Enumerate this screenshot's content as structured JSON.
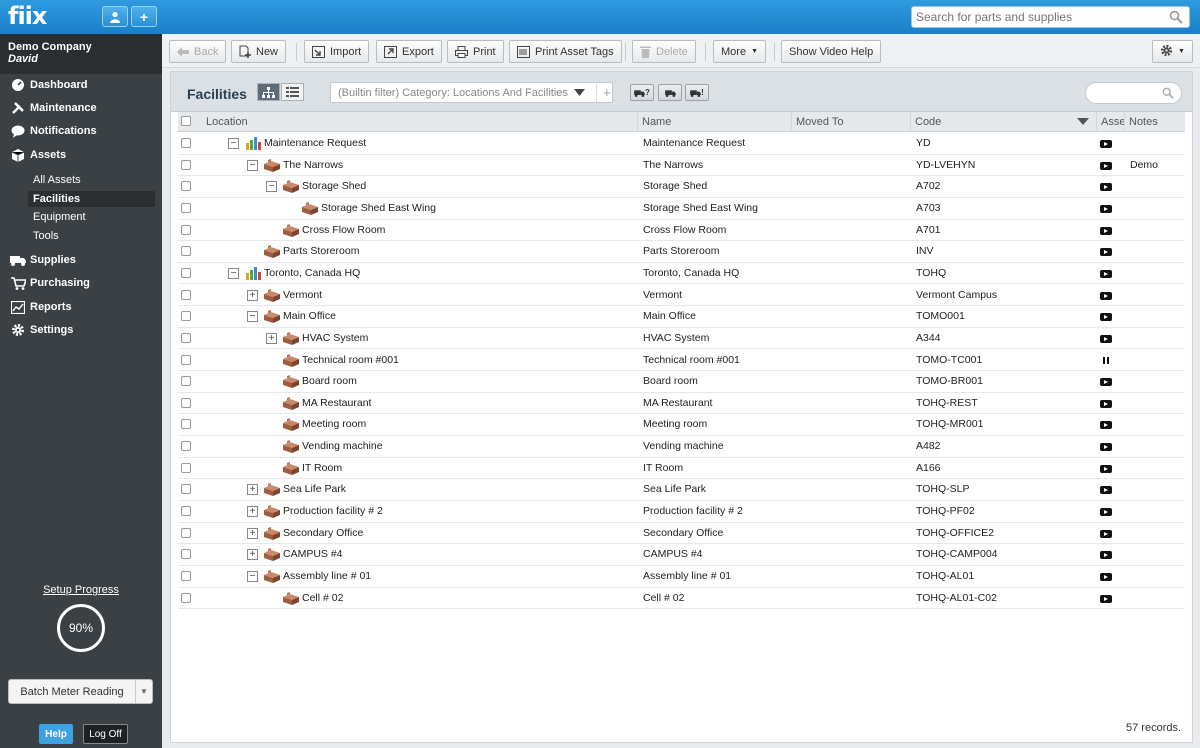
{
  "app": {
    "logo": "fiix",
    "search_placeholder": "Search for parts and supplies"
  },
  "sidebar": {
    "company": "Demo Company",
    "user": "David",
    "nav": [
      {
        "label": "Dashboard",
        "icon": "dashboard-icon"
      },
      {
        "label": "Maintenance",
        "icon": "wrench-icon"
      },
      {
        "label": "Notifications",
        "icon": "chat-bubble-icon"
      },
      {
        "label": "Assets",
        "icon": "box-icon"
      },
      {
        "label": "Supplies",
        "icon": "truck-icon"
      },
      {
        "label": "Purchasing",
        "icon": "cart-icon"
      },
      {
        "label": "Reports",
        "icon": "chart-icon"
      },
      {
        "label": "Settings",
        "icon": "gear-icon"
      }
    ],
    "asset_sub": [
      "All Assets",
      "Facilities",
      "Equipment",
      "Tools"
    ],
    "setup_label": "Setup Progress",
    "setup_value": "90%",
    "batch_label": "Batch Meter Reading",
    "help_label": "Help",
    "logoff_label": "Log Off"
  },
  "toolbar": {
    "back": "Back",
    "new": "New",
    "import": "Import",
    "export": "Export",
    "print": "Print",
    "print_tags": "Print Asset Tags",
    "delete": "Delete",
    "more": "More",
    "video_help": "Show Video Help"
  },
  "panel": {
    "title": "Facilities",
    "filter_text": "(Builtin filter) Category: Locations And Facilities",
    "filter_add": "+",
    "tag_labels": [
      "?",
      "",
      "!"
    ],
    "records": "57 records."
  },
  "columns": {
    "location": "Location",
    "name": "Name",
    "moved_to": "Moved To",
    "code": "Code",
    "asset": "Asset",
    "notes": "Notes"
  },
  "colors": {
    "topbar": "#1b7fc7",
    "sidebar": "#3b4044",
    "accent": "#3da1e3"
  },
  "rows": [
    {
      "level": 0,
      "toggle": "−",
      "icon": "green",
      "location": "Maintenance Request",
      "name": "Maintenance Request",
      "moved_to": "",
      "code": "YD",
      "status": "play",
      "notes": ""
    },
    {
      "level": 1,
      "toggle": "−",
      "icon": "brown",
      "location": "The Narrows",
      "name": "The Narrows",
      "moved_to": "",
      "code": "YD-LVEHYN",
      "status": "play",
      "notes": "Demo"
    },
    {
      "level": 2,
      "toggle": "−",
      "icon": "brown",
      "location": "Storage Shed",
      "name": "Storage Shed",
      "moved_to": "",
      "code": "A702",
      "status": "play",
      "notes": ""
    },
    {
      "level": 3,
      "toggle": "",
      "icon": "brown",
      "location": "Storage Shed East Wing",
      "name": "Storage Shed East Wing",
      "moved_to": "",
      "code": "A703",
      "status": "play",
      "notes": ""
    },
    {
      "level": 2,
      "toggle": "",
      "icon": "brown",
      "location": "Cross Flow Room",
      "name": "Cross Flow Room",
      "moved_to": "",
      "code": "A701",
      "status": "play",
      "notes": ""
    },
    {
      "level": 1,
      "toggle": "",
      "icon": "brown",
      "location": "Parts Storeroom",
      "name": "Parts Storeroom",
      "moved_to": "",
      "code": "INV",
      "status": "play",
      "notes": ""
    },
    {
      "level": 0,
      "toggle": "−",
      "icon": "green",
      "location": "Toronto, Canada HQ",
      "name": "Toronto, Canada HQ",
      "moved_to": "",
      "code": "TOHQ",
      "status": "play",
      "notes": ""
    },
    {
      "level": 1,
      "toggle": "+",
      "icon": "brown",
      "location": "Vermont",
      "name": "Vermont",
      "moved_to": "",
      "code": "Vermont Campus",
      "status": "play",
      "notes": ""
    },
    {
      "level": 1,
      "toggle": "−",
      "icon": "brown",
      "location": "Main Office",
      "name": "Main Office",
      "moved_to": "",
      "code": "TOMO001",
      "status": "play",
      "notes": ""
    },
    {
      "level": 2,
      "toggle": "+",
      "icon": "brown",
      "location": "HVAC System",
      "name": "HVAC System",
      "moved_to": "",
      "code": "A344",
      "status": "play",
      "notes": ""
    },
    {
      "level": 2,
      "toggle": "",
      "icon": "brown",
      "location": "Technical room #001",
      "name": "Technical room #001",
      "moved_to": "",
      "code": "TOMO-TC001",
      "status": "pause",
      "notes": ""
    },
    {
      "level": 2,
      "toggle": "",
      "icon": "brown",
      "location": "Board room",
      "name": "Board room",
      "moved_to": "",
      "code": "TOMO-BR001",
      "status": "play",
      "notes": ""
    },
    {
      "level": 2,
      "toggle": "",
      "icon": "brown",
      "location": "MA Restaurant",
      "name": "MA Restaurant",
      "moved_to": "",
      "code": "TOHQ-REST",
      "status": "play",
      "notes": ""
    },
    {
      "level": 2,
      "toggle": "",
      "icon": "brown",
      "location": "Meeting room",
      "name": "Meeting room",
      "moved_to": "",
      "code": "TOHQ-MR001",
      "status": "play",
      "notes": ""
    },
    {
      "level": 2,
      "toggle": "",
      "icon": "brown",
      "location": "Vending machine",
      "name": "Vending machine",
      "moved_to": "",
      "code": "A482",
      "status": "play",
      "notes": ""
    },
    {
      "level": 2,
      "toggle": "",
      "icon": "brown",
      "location": "IT Room",
      "name": "IT Room",
      "moved_to": "",
      "code": "A166",
      "status": "play",
      "notes": ""
    },
    {
      "level": 1,
      "toggle": "+",
      "icon": "brown",
      "location": "Sea Life Park",
      "name": "Sea Life Park",
      "moved_to": "",
      "code": "TOHQ-SLP",
      "status": "play",
      "notes": ""
    },
    {
      "level": 1,
      "toggle": "+",
      "icon": "brown",
      "location": "Production facility # 2",
      "name": "Production facility # 2",
      "moved_to": "",
      "code": "TOHQ-PF02",
      "status": "play",
      "notes": ""
    },
    {
      "level": 1,
      "toggle": "+",
      "icon": "brown",
      "location": "Secondary Office",
      "name": "Secondary Office",
      "moved_to": "",
      "code": "TOHQ-OFFICE2",
      "status": "play",
      "notes": ""
    },
    {
      "level": 1,
      "toggle": "+",
      "icon": "brown",
      "location": "CAMPUS #4",
      "name": "CAMPUS #4",
      "moved_to": "",
      "code": "TOHQ-CAMP004",
      "status": "play",
      "notes": ""
    },
    {
      "level": 1,
      "toggle": "−",
      "icon": "brown",
      "location": "Assembly line # 01",
      "name": "Assembly line # 01",
      "moved_to": "",
      "code": "TOHQ-AL01",
      "status": "play",
      "notes": ""
    },
    {
      "level": 2,
      "toggle": "",
      "icon": "brown",
      "location": "Cell # 02",
      "name": "Cell # 02",
      "moved_to": "",
      "code": "TOHQ-AL01-C02",
      "status": "play",
      "notes": ""
    }
  ]
}
